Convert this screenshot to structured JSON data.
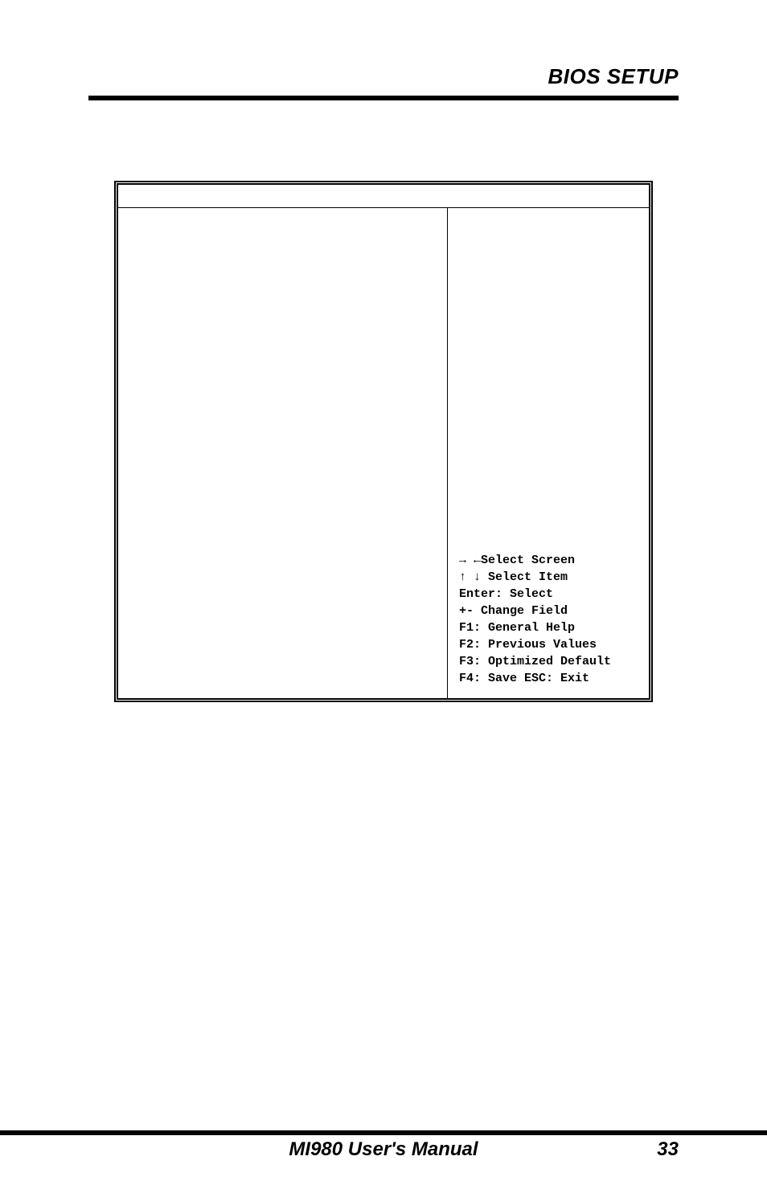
{
  "header": {
    "title": "BIOS SETUP"
  },
  "panel": {
    "nav": {
      "select_screen": "→ ←Select Screen",
      "select_item": "↑ ↓ Select Item",
      "enter": "Enter: Select",
      "change": "+-  Change Field",
      "f1": "F1: General Help",
      "f2": "F2: Previous Values",
      "f3": "F3: Optimized Default",
      "f4": "F4: Save  ESC: Exit"
    }
  },
  "footer": {
    "manual": "MI980 User's Manual",
    "page": "33"
  }
}
